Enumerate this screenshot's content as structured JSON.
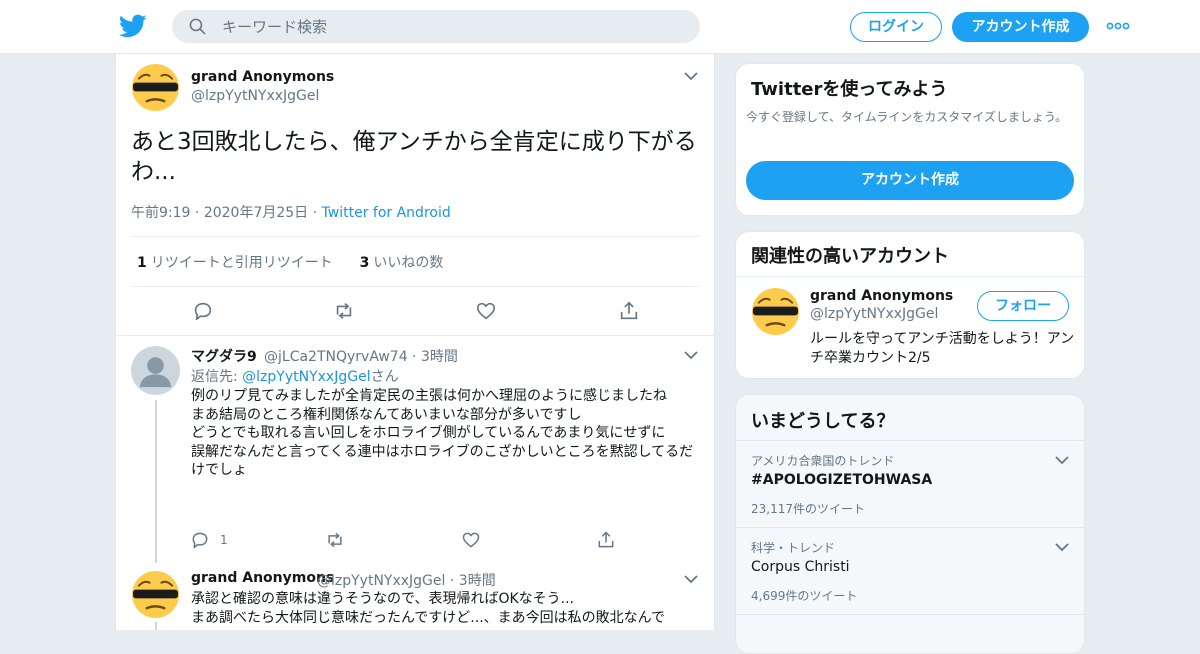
{
  "header": {
    "search_placeholder": "キーワード検索",
    "login_label": "ログイン",
    "signup_label": "アカウント作成"
  },
  "main_tweet": {
    "name": "grand Anonymons",
    "handle": "@lzpYytNYxxJgGel",
    "text": "あと3回敗北したら、俺アンチから全肯定に成り下がるわ...",
    "time": "午前9:19",
    "date": "2020年7月25日",
    "source": "Twitter for Android",
    "retweet_count": "1",
    "retweet_label": "リツイートと引用リツイート",
    "like_count": "3",
    "like_label": "いいねの数"
  },
  "replies": [
    {
      "name": "マグダラ9",
      "handle": "@jLCa2TNQyrvAw74",
      "time": "3時間",
      "replying_prefix": "返信先: ",
      "replying_to": "@lzpYytNYxxJgGel",
      "replying_suffix": "さん",
      "lines": [
        "例のリプ見てみましたが全肯定民の主張は何かへ理屈のように感じましたね",
        "まあ結局のところ権利関係なんてあいまいな部分が多いですし",
        "どうとでも取れる言い回しをホロライブ側がしているんであまり気にせずに",
        "誤解だなんだと言ってくる連中はホロライブのこざかしいところを黙認してるだけでしょ"
      ],
      "reply_count": "1"
    },
    {
      "name": "grand Anonymons",
      "handle": "@lzpYytNYxxJgGel",
      "time": "3時間",
      "lines": [
        "承認と確認の意味は違うそうなので、表現帰ればOKなそう...",
        "まあ調べたら大体同じ意味だったんですけど...、まあ今回は私の敗北なんで"
      ]
    }
  ],
  "signup_card": {
    "title": "Twitterを使ってみよう",
    "subtitle": "今すぐ登録して、タイムラインをカスタマイズしましょう。",
    "button": "アカウント作成"
  },
  "related_card": {
    "title": "関連性の高いアカウント",
    "name": "grand Anonymons",
    "handle": "@lzpYytNYxxJgGel",
    "follow_label": "フォロー",
    "bio": "ルールを守ってアンチ活動をしよう！アンチ卒業カウント2/5"
  },
  "trends_card": {
    "title": "いまどうしてる？",
    "trends": [
      {
        "category": "アメリカ合衆国のトレンド",
        "name": "#APOLOGIZETOHWASA",
        "count": "23,117件のツイート"
      },
      {
        "category": "科学・トレンド",
        "name": "Corpus Christi",
        "count": "4,699件のツイート"
      }
    ]
  },
  "colors": {
    "accent": "#1da1f2",
    "link": "#1b95e0",
    "muted": "#657786",
    "border": "#e1e8ed",
    "background": "#e6ecf0"
  }
}
